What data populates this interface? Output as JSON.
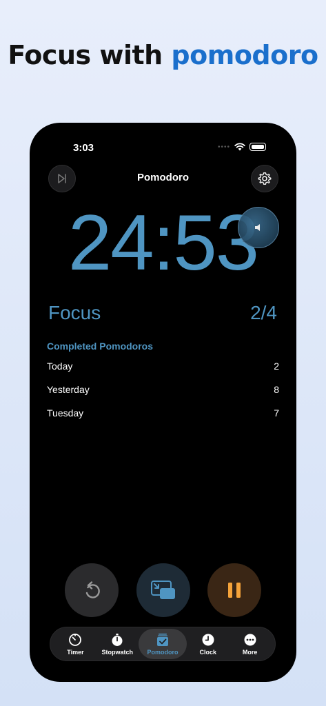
{
  "headline": {
    "prefix": "Focus with ",
    "accent": "pomodoro"
  },
  "status_bar": {
    "time": "3:03",
    "dots": "••••"
  },
  "header": {
    "title": "Pomodoro"
  },
  "timer": {
    "display": "24:53"
  },
  "session": {
    "label": "Focus",
    "count": "2/4"
  },
  "stats": {
    "title": "Completed Pomodoros",
    "rows": [
      {
        "label": "Today",
        "value": "2"
      },
      {
        "label": "Yesterday",
        "value": "8"
      },
      {
        "label": "Tuesday",
        "value": "7"
      }
    ]
  },
  "tabs": [
    {
      "label": "Timer",
      "icon": "timer-icon"
    },
    {
      "label": "Stopwatch",
      "icon": "stopwatch-icon"
    },
    {
      "label": "Pomodoro",
      "icon": "pomodoro-icon"
    },
    {
      "label": "Clock",
      "icon": "clock-icon"
    },
    {
      "label": "More",
      "icon": "more-icon"
    }
  ],
  "colors": {
    "accent": "#4f95c2",
    "headline_accent": "#1a6fcc",
    "pause_orange": "#f5a33a",
    "background": "#000000"
  }
}
